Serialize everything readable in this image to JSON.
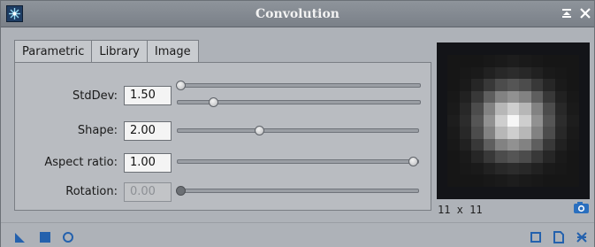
{
  "window": {
    "title": "Convolution"
  },
  "tabs": [
    {
      "label": "Parametric",
      "active": true
    },
    {
      "label": "Library",
      "active": false
    },
    {
      "label": "Image",
      "active": false
    }
  ],
  "params": {
    "stddev": {
      "label": "StdDev:",
      "value": "1.50",
      "coarse_fraction": 0.0,
      "fine_fraction": 0.15
    },
    "shape": {
      "label": "Shape:",
      "value": "2.00",
      "fraction": 0.34
    },
    "aspect": {
      "label": "Aspect ratio:",
      "value": "1.00",
      "fraction": 1.0
    },
    "rotation": {
      "label": "Rotation:",
      "value": "0.00",
      "fraction": 0.0,
      "disabled": true
    }
  },
  "preview": {
    "size_label": "11 x 11",
    "grid": [
      [
        0.0,
        0.0,
        0.0,
        0.01,
        0.02,
        0.03,
        0.02,
        0.01,
        0.0,
        0.0,
        0.0
      ],
      [
        0.0,
        0.01,
        0.02,
        0.05,
        0.08,
        0.1,
        0.08,
        0.05,
        0.02,
        0.01,
        0.0
      ],
      [
        0.0,
        0.02,
        0.07,
        0.15,
        0.24,
        0.28,
        0.24,
        0.15,
        0.07,
        0.02,
        0.0
      ],
      [
        0.01,
        0.05,
        0.15,
        0.32,
        0.48,
        0.55,
        0.48,
        0.32,
        0.15,
        0.05,
        0.01
      ],
      [
        0.02,
        0.08,
        0.24,
        0.48,
        0.72,
        0.82,
        0.72,
        0.48,
        0.24,
        0.08,
        0.02
      ],
      [
        0.03,
        0.1,
        0.28,
        0.55,
        0.82,
        1.0,
        0.82,
        0.55,
        0.28,
        0.1,
        0.03
      ],
      [
        0.02,
        0.08,
        0.24,
        0.48,
        0.72,
        0.82,
        0.72,
        0.48,
        0.24,
        0.08,
        0.02
      ],
      [
        0.01,
        0.05,
        0.15,
        0.32,
        0.48,
        0.55,
        0.48,
        0.32,
        0.15,
        0.05,
        0.01
      ],
      [
        0.0,
        0.02,
        0.07,
        0.15,
        0.24,
        0.28,
        0.24,
        0.15,
        0.07,
        0.02,
        0.0
      ],
      [
        0.0,
        0.01,
        0.02,
        0.05,
        0.08,
        0.1,
        0.08,
        0.05,
        0.02,
        0.01,
        0.0
      ],
      [
        0.0,
        0.0,
        0.0,
        0.01,
        0.02,
        0.03,
        0.02,
        0.01,
        0.0,
        0.0,
        0.0
      ]
    ]
  },
  "icons": {
    "app": "convolution-app-icon",
    "shade": "shade-icon",
    "close": "close-icon",
    "camera": "camera-icon",
    "new_instance": "new-instance-icon",
    "apply": "apply-icon",
    "apply_global": "apply-global-icon",
    "preview": "preview-icon",
    "document": "document-icon",
    "reset": "reset-icon"
  },
  "colors": {
    "accent": "#1f5fa8",
    "title_bg": "#858b92",
    "panel_bg": "#b9bcc1"
  }
}
